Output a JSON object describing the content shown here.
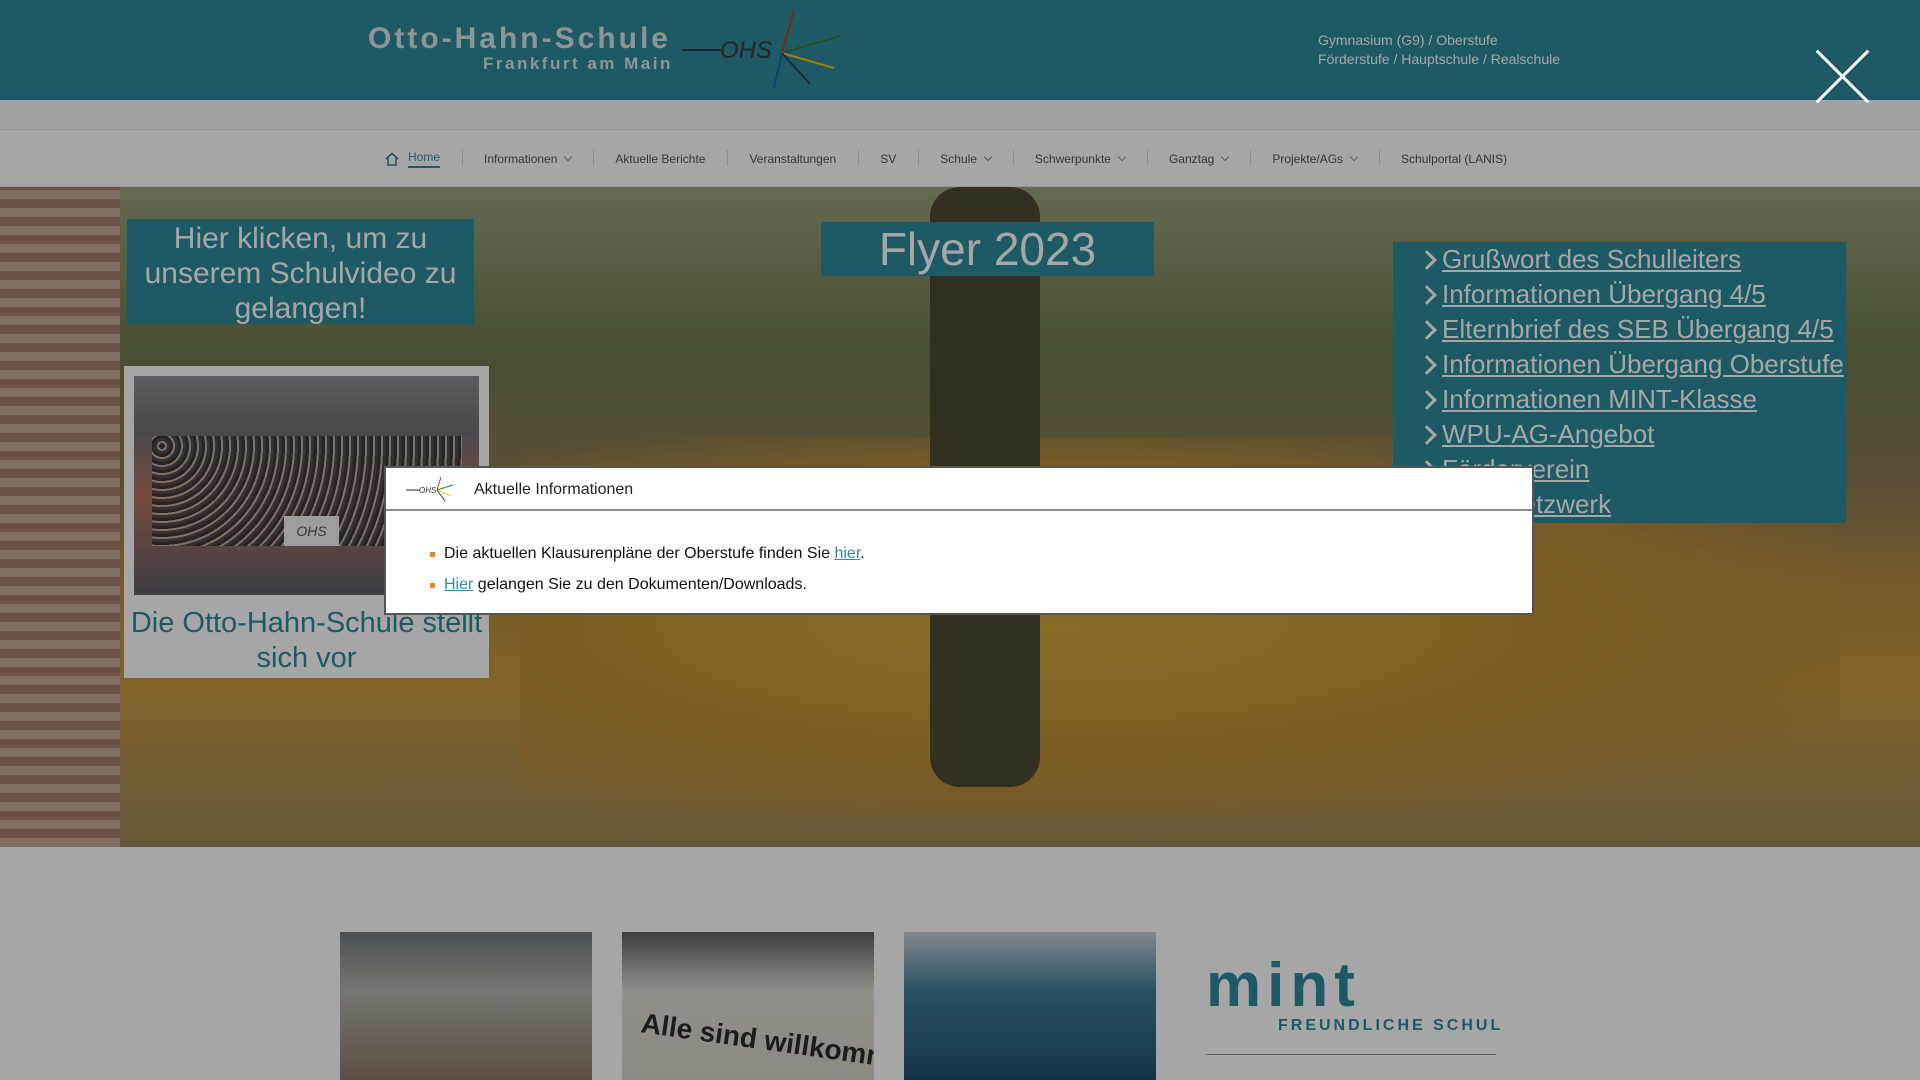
{
  "header": {
    "logo_name": "Otto-Hahn-Schule",
    "logo_city": "Frankfurt am Main",
    "logo_mark_text": "OHS",
    "tagline_line1": "Gymnasium (G9) / Oberstufe",
    "tagline_line2": "Förderstufe / Hauptschule / Realschule"
  },
  "nav": {
    "items": [
      {
        "label": "Home",
        "active": true,
        "icon": "home-icon"
      },
      {
        "label": "Informationen",
        "dropdown": true
      },
      {
        "label": "Aktuelle Berichte"
      },
      {
        "label": "Veranstaltungen"
      },
      {
        "label": "SV"
      },
      {
        "label": "Schule",
        "dropdown": true
      },
      {
        "label": "Schwerpunkte",
        "dropdown": true
      },
      {
        "label": "Ganztag",
        "dropdown": true
      },
      {
        "label": "Projekte/AGs",
        "dropdown": true
      },
      {
        "label": "Schulportal (LANIS)"
      }
    ]
  },
  "hero": {
    "video_button": "Hier klicken, um zu unserem Schulvideo zu gelangen!",
    "flyer_button": "Flyer 2023",
    "card_banner": "OHS",
    "card_caption": "Die Otto-Hahn-Schule stellt sich vor",
    "links": [
      "Grußwort des Schulleiters",
      "Informationen Übergang 4/5",
      "Elternbrief des SEB Übergang 4/5",
      "Informationen Übergang Oberstufe",
      "Informationen MINT-Klasse",
      "WPU-AG-Angebot",
      "Förderverein",
      "Schulnetzwerk"
    ]
  },
  "tiles": {
    "welcome_text": "Alle sind willkommen",
    "mint_word": "mint",
    "mint_sub": "FREUNDLICHE SCHULE"
  },
  "modal": {
    "title": "Aktuelle Informationen",
    "item1_before": "Die aktuellen Klausurenpläne der Oberstufe finden Sie ",
    "item1_link": "hier",
    "item1_after": ".",
    "item2_link": "Hier",
    "item2_after": " gelangen Sie zu den Dokumenten/Downloads."
  },
  "colors": {
    "brand": "#2e8b9c",
    "bullet": "#e8822a",
    "link": "#2e8bb0"
  }
}
